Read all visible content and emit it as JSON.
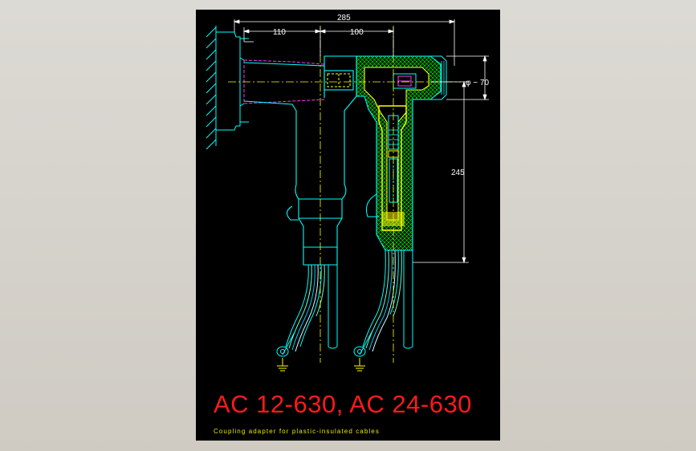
{
  "drawing": {
    "title": "AC 12-630, AC 24-630",
    "subtitle": "Coupling adapter for plastic-insulated cables",
    "dimensions": {
      "overall_width": "285",
      "left_width": "110",
      "right_width": "100",
      "height": "245",
      "diameter": "φ ~ 70"
    },
    "colors": {
      "background": "#000000",
      "outline": "#00ffff",
      "insulation_hatch": "#00ff00",
      "yellow_parts": "#ffff00",
      "magenta_hidden": "#ff00ff",
      "title_red": "#ff1a1a",
      "dimension_white": "#ffffff"
    }
  }
}
